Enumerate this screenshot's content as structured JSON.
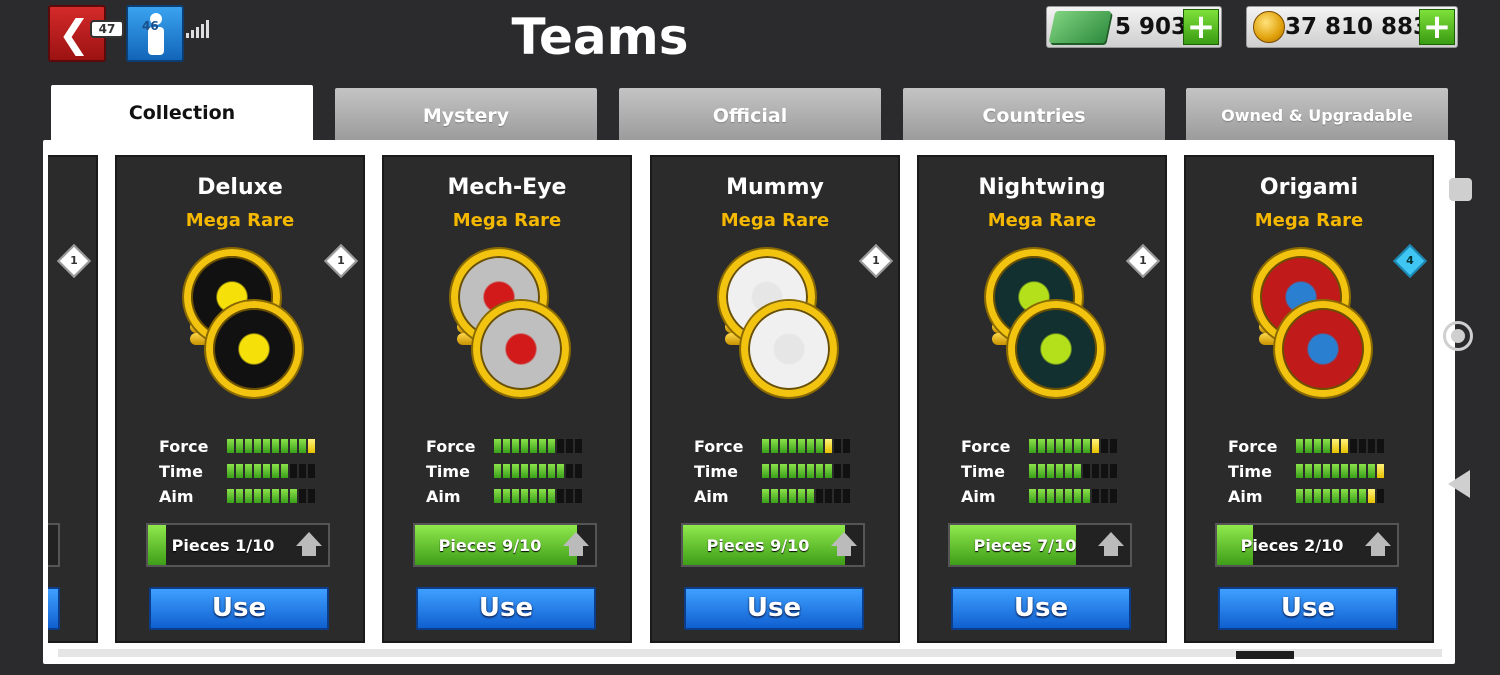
{
  "header": {
    "title": "Teams",
    "battery": "47",
    "profile_level": "46",
    "cash": "5 903",
    "coins": "37 810 883",
    "plus": "+"
  },
  "tabs": [
    {
      "label": "Collection",
      "active": true
    },
    {
      "label": "Mystery",
      "active": false
    },
    {
      "label": "Official",
      "active": false
    },
    {
      "label": "Countries",
      "active": false
    },
    {
      "label": "Owned & Upgradable",
      "active": false
    }
  ],
  "labels": {
    "force": "Force",
    "time": "Time",
    "aim": "Aim",
    "use": "Use"
  },
  "cards": [
    {
      "name": "Deluxe",
      "rarity": "Mega Rare",
      "badge": "1",
      "badge_color": "white",
      "coin_color": "#f6e00a",
      "coin_bg": "#111111",
      "symbol": "diamond-icon",
      "force": {
        "green": 9,
        "yellow": 1,
        "total": 10
      },
      "time": {
        "green": 7,
        "yellow": 0,
        "total": 10
      },
      "aim": {
        "green": 8,
        "yellow": 0,
        "total": 10
      },
      "pieces": "Pieces 1/10",
      "progress": 0.1
    },
    {
      "name": "Mech-Eye",
      "rarity": "Mega Rare",
      "badge": "",
      "badge_color": "white",
      "coin_color": "#d21a1a",
      "coin_bg": "#bfbfbf",
      "symbol": "robot-eye-icon",
      "force": {
        "green": 7,
        "yellow": 0,
        "total": 10
      },
      "time": {
        "green": 8,
        "yellow": 0,
        "total": 10
      },
      "aim": {
        "green": 7,
        "yellow": 0,
        "total": 10
      },
      "pieces": "Pieces 9/10",
      "progress": 0.9
    },
    {
      "name": "Mummy",
      "rarity": "Mega Rare",
      "badge": "1",
      "badge_color": "white",
      "coin_color": "#e6e6e6",
      "coin_bg": "#f0f0f0",
      "symbol": "mummy-icon",
      "force": {
        "green": 7,
        "yellow": 1,
        "total": 10
      },
      "time": {
        "green": 8,
        "yellow": 0,
        "total": 10
      },
      "aim": {
        "green": 6,
        "yellow": 0,
        "total": 10
      },
      "pieces": "Pieces 9/10",
      "progress": 0.9
    },
    {
      "name": "Nightwing",
      "rarity": "Mega Rare",
      "badge": "1",
      "badge_color": "white",
      "coin_color": "#b3e01a",
      "coin_bg": "#123030",
      "symbol": "bat-icon",
      "force": {
        "green": 7,
        "yellow": 1,
        "total": 10
      },
      "time": {
        "green": 6,
        "yellow": 0,
        "total": 10
      },
      "aim": {
        "green": 7,
        "yellow": 0,
        "total": 10
      },
      "pieces": "Pieces 7/10",
      "progress": 0.7
    },
    {
      "name": "Origami",
      "rarity": "Mega Rare",
      "badge": "4",
      "badge_color": "blue",
      "coin_color": "#2a7fd0",
      "coin_bg": "#c01a1a",
      "symbol": "origami-swan-icon",
      "force": {
        "green": 4,
        "yellow": 2,
        "total": 10
      },
      "time": {
        "green": 9,
        "yellow": 1,
        "total": 10
      },
      "aim": {
        "green": 8,
        "yellow": 1,
        "total": 10
      },
      "pieces": "Pieces 2/10",
      "progress": 0.2
    }
  ],
  "partial_card": {
    "badge": "1"
  },
  "colors": {
    "accent_yellow": "#f5b800",
    "use_blue": "#1a72e0",
    "bar_green": "#5ac22a"
  }
}
